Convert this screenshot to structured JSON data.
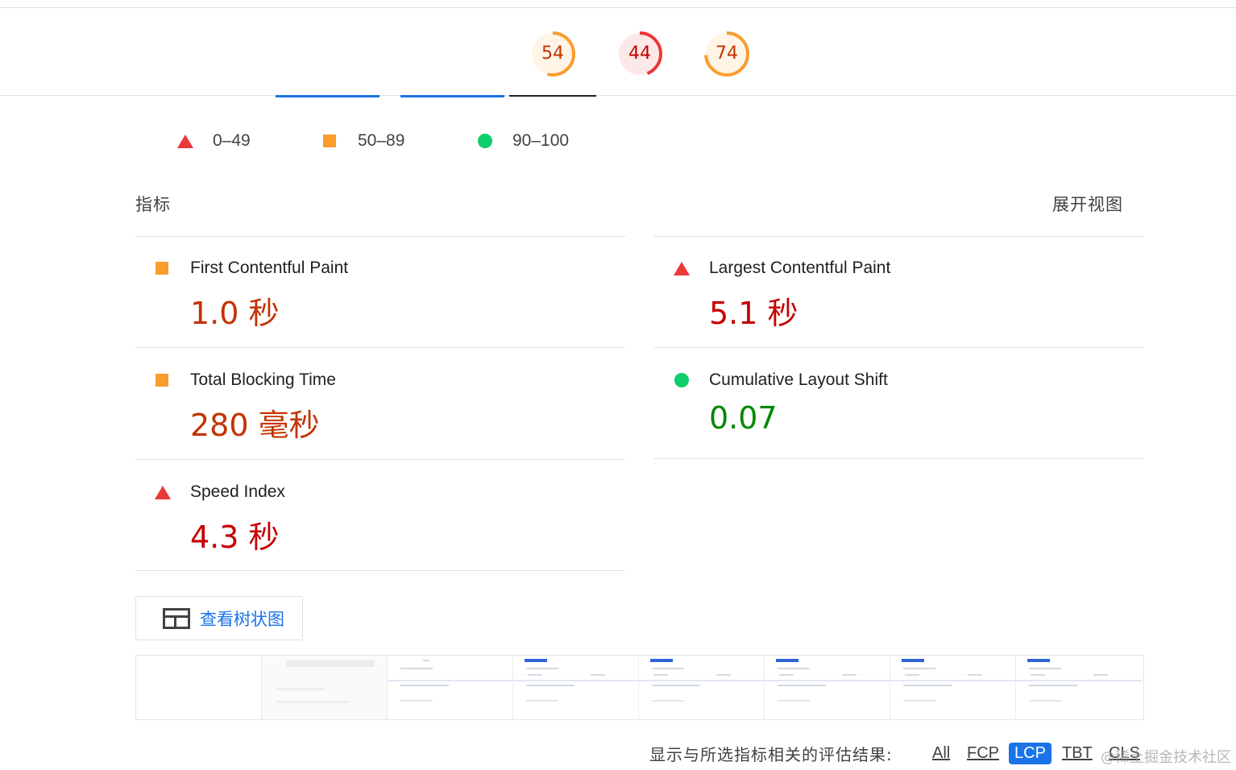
{
  "colors": {
    "fail": "#eb3838",
    "average": "#fa9d2d",
    "pass": "#0cce6b",
    "link_blue": "#1a73e8",
    "avg_text": "#c33300",
    "fail_text": "#c60000",
    "pass_text": "#008800"
  },
  "gauges": [
    {
      "score": "54",
      "value": 54,
      "rating": "average"
    },
    {
      "score": "44",
      "value": 44,
      "rating": "fail"
    },
    {
      "score": "74",
      "value": 74,
      "rating": "average"
    }
  ],
  "legend": [
    {
      "icon": "triangle-icon",
      "label": "0–49"
    },
    {
      "icon": "square-icon",
      "label": "50–89"
    },
    {
      "icon": "circle-icon",
      "label": "90–100"
    }
  ],
  "metrics_section": {
    "title": "指标",
    "expand_label": "展开视图"
  },
  "metrics": [
    {
      "name": "First Contentful Paint",
      "value": "1.0 秒",
      "rating": "average"
    },
    {
      "name": "Largest Contentful Paint",
      "value": "5.1 秒",
      "rating": "fail"
    },
    {
      "name": "Total Blocking Time",
      "value": "280 毫秒",
      "rating": "average"
    },
    {
      "name": "Cumulative Layout Shift",
      "value": "0.07",
      "rating": "pass"
    },
    {
      "name": "Speed Index",
      "value": "4.3 秒",
      "rating": "fail"
    }
  ],
  "treemap_button": {
    "label": "查看树状图",
    "icon": "treemap-icon"
  },
  "filmstrip": {
    "frame_count": 8
  },
  "filter": {
    "label": "显示与所选指标相关的评估结果:",
    "chips": [
      "All",
      "FCP",
      "LCP",
      "TBT",
      "CLS"
    ],
    "active": "LCP"
  },
  "watermark": "@稀土掘金技术社区"
}
